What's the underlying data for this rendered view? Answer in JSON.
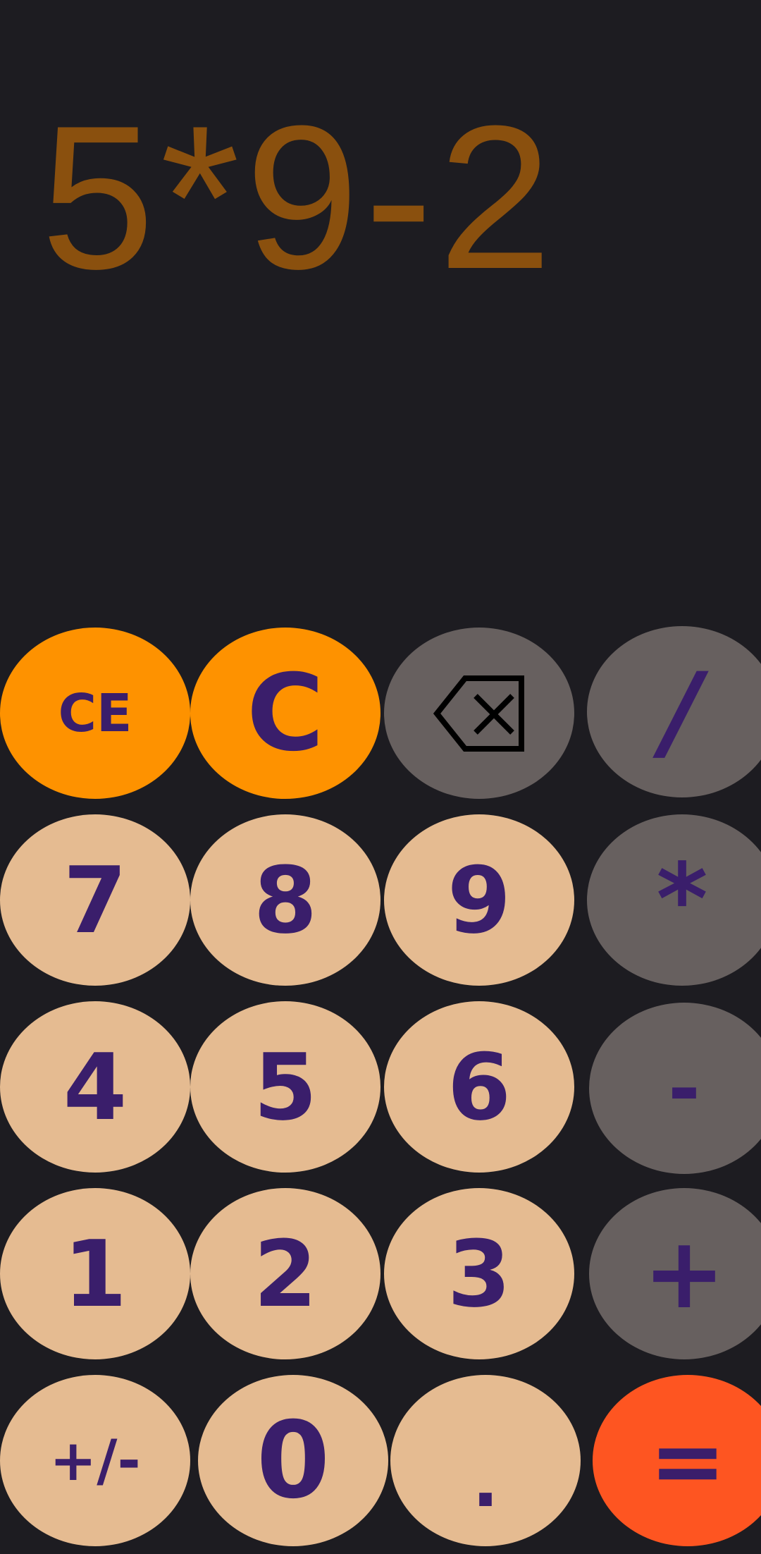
{
  "display": {
    "expression": "5*9-2"
  },
  "keys": {
    "ce": "CE",
    "c": "C",
    "backspace_icon": "backspace-icon",
    "divide": "/",
    "seven": "7",
    "eight": "8",
    "nine": "9",
    "multiply": "*",
    "four": "4",
    "five": "5",
    "six": "6",
    "subtract": "-",
    "one": "1",
    "two": "2",
    "three": "3",
    "add": "+",
    "negate": "+/-",
    "zero": "0",
    "decimal": ".",
    "equals": "="
  },
  "colors": {
    "background": "#1d1c21",
    "expression_text": "#8a500e",
    "digit_key": "#e5bb91",
    "function_key": "#fe9200",
    "operator_key": "#67605f",
    "equals_key": "#fe5521",
    "key_text": "#3a1e6b"
  }
}
